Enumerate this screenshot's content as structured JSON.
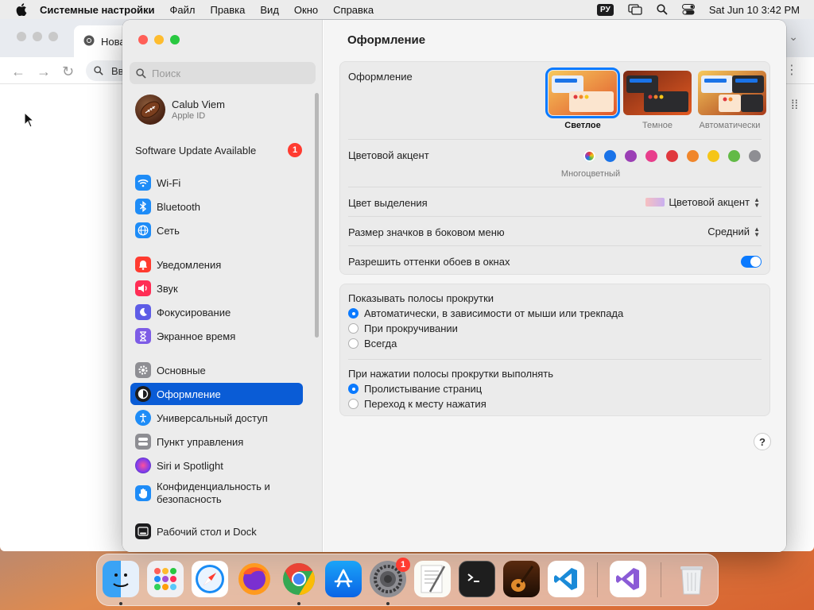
{
  "menubar": {
    "app_name": "Системные настройки",
    "items": [
      "Файл",
      "Правка",
      "Вид",
      "Окно",
      "Справка"
    ],
    "input_lang": "РУ",
    "clock": "Sat Jun 10  3:42 PM"
  },
  "browser": {
    "tab_title": "Нова",
    "omnibox_text": "Вв"
  },
  "sidebar": {
    "search_placeholder": "Поиск",
    "account": {
      "name": "Calub Viem",
      "sub": "Apple ID"
    },
    "update": {
      "label": "Software Update Available",
      "badge": "1"
    },
    "items": [
      {
        "label": "Wi-Fi",
        "icon": "wifi-icon",
        "color": "#1e8cf7"
      },
      {
        "label": "Bluetooth",
        "icon": "bluetooth-icon",
        "color": "#1e8cf7"
      },
      {
        "label": "Сеть",
        "icon": "globe-icon",
        "color": "#1e8cf7"
      },
      {
        "label": "Уведомления",
        "icon": "bell-icon",
        "color": "#ff3b30"
      },
      {
        "label": "Звук",
        "icon": "speaker-icon",
        "color": "#ff2d55"
      },
      {
        "label": "Фокусирование",
        "icon": "moon-icon",
        "color": "#5e5ce6"
      },
      {
        "label": "Экранное время",
        "icon": "hourglass-icon",
        "color": "#7d5ce6"
      },
      {
        "label": "Основные",
        "icon": "gear-icon",
        "color": "#8e8e93"
      },
      {
        "label": "Оформление",
        "icon": "appearance-icon",
        "color": "#1c1c1e"
      },
      {
        "label": "Универсальный доступ",
        "icon": "accessibility-icon",
        "color": "#1e8cf7"
      },
      {
        "label": "Пункт управления",
        "icon": "control-center-icon",
        "color": "#8e8e93"
      },
      {
        "label": "Siri и Spotlight",
        "icon": "siri-icon",
        "color": "#a34fd6"
      },
      {
        "label": "Конфиденциальность и безопасность",
        "icon": "hand-icon",
        "color": "#1e8cf7"
      },
      {
        "label": "Рабочий стол и Dock",
        "icon": "dock-icon",
        "color": "#1c1c1e"
      }
    ]
  },
  "main": {
    "title": "Оформление",
    "appearance": {
      "label": "Оформление",
      "options": [
        {
          "label": "Светлое",
          "selected": true
        },
        {
          "label": "Темное",
          "selected": false
        },
        {
          "label": "Автоматически",
          "selected": false
        }
      ]
    },
    "accent": {
      "label": "Цветовой акцент",
      "selected_name": "Многоцветный",
      "colors": [
        "multicolor",
        "#1a73e8",
        "#9b3fb5",
        "#e83e8c",
        "#e0383e",
        "#f0862b",
        "#f5c518",
        "#62ba46",
        "#8e8e93"
      ]
    },
    "highlight": {
      "label": "Цвет выделения",
      "value": "Цветовой акцент"
    },
    "sidebar_icon_size": {
      "label": "Размер значков в боковом меню",
      "value": "Средний"
    },
    "wallpaper_tinting": {
      "label": "Разрешить оттенки обоев в окнах",
      "on": true
    },
    "scrollbars": {
      "label": "Показывать полосы прокрутки",
      "options": [
        {
          "label": "Автоматически, в зависимости от мыши или трекпада",
          "selected": true
        },
        {
          "label": "При прокручивании",
          "selected": false
        },
        {
          "label": "Всегда",
          "selected": false
        }
      ]
    },
    "scroll_click": {
      "label": "При нажатии полосы прокрутки выполнять",
      "options": [
        {
          "label": "Пролистывание страниц",
          "selected": true
        },
        {
          "label": "Переход к месту нажатия",
          "selected": false
        }
      ]
    },
    "help": "?"
  },
  "dock": {
    "apps": [
      "Finder",
      "Launchpad",
      "Safari",
      "Firefox",
      "Chrome",
      "App Store",
      "Системные настройки",
      "TextEdit",
      "Terminal",
      "GarageBand",
      "VS Code",
      "Visual Studio",
      "Корзина"
    ],
    "settings_badge": "1"
  }
}
